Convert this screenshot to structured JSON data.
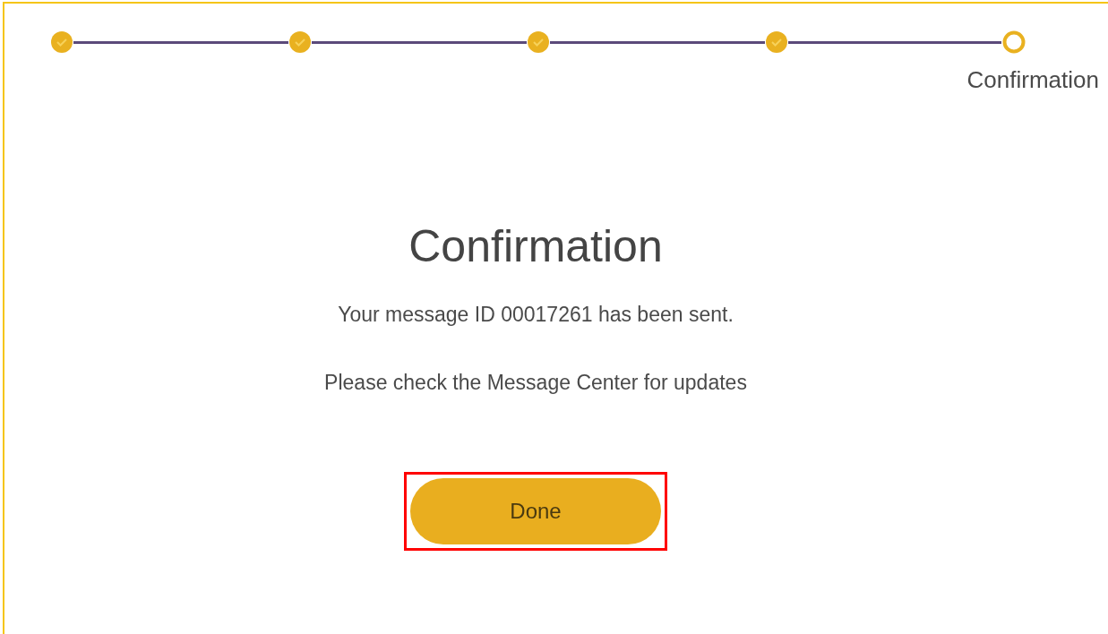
{
  "stepper": {
    "steps": [
      {
        "completed": true
      },
      {
        "completed": true
      },
      {
        "completed": true
      },
      {
        "completed": true
      },
      {
        "completed": false,
        "label": "Confirmation"
      }
    ]
  },
  "title": "Confirmation",
  "messages": [
    "Your message ID 00017261 has been sent.",
    "Please check the Message Center for updates"
  ],
  "done_button": {
    "label": "Done",
    "highlighted": true
  }
}
